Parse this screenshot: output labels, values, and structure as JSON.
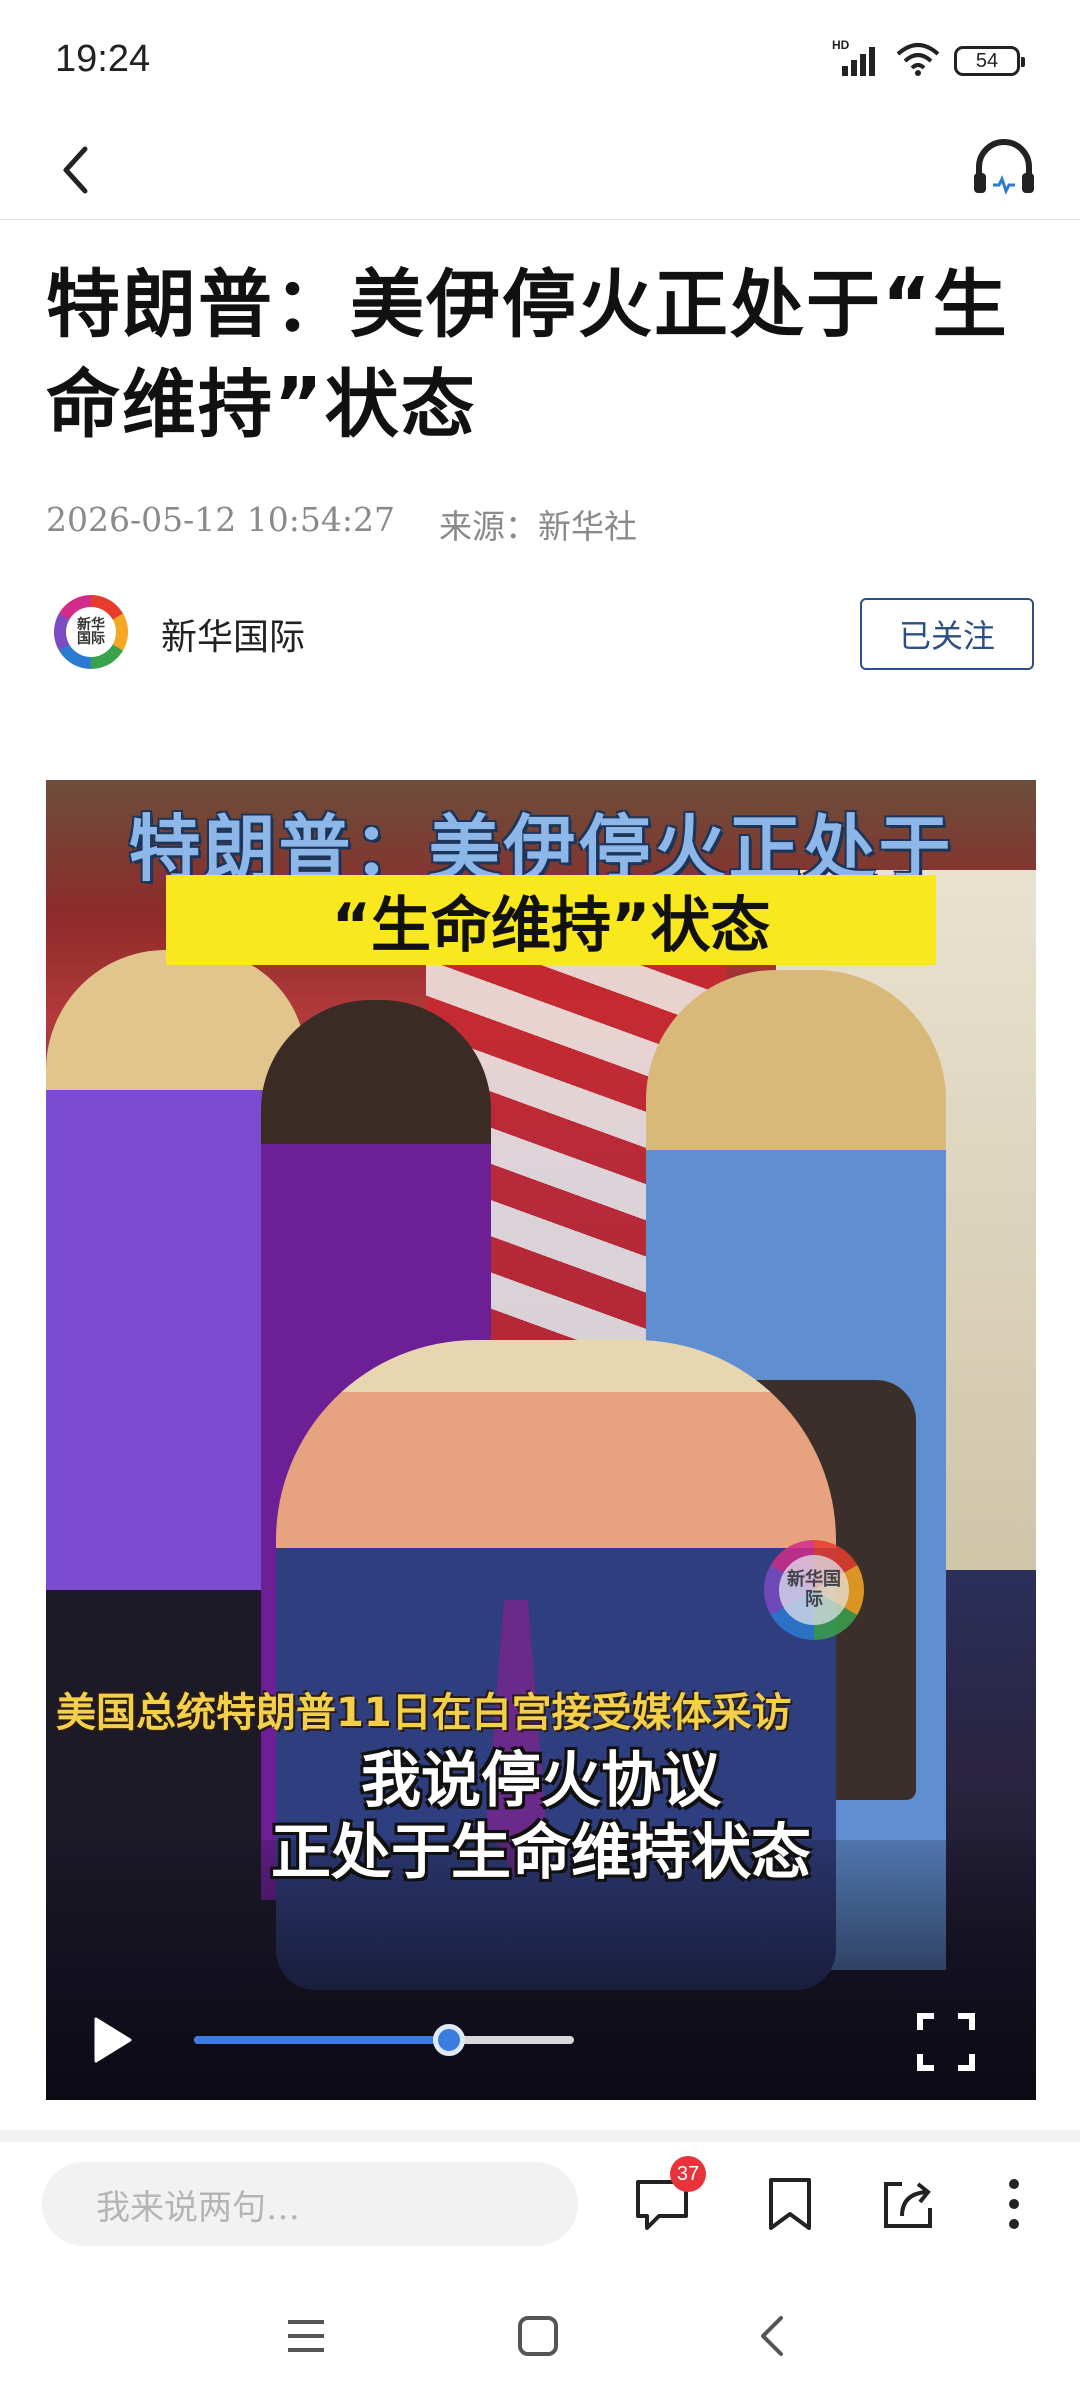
{
  "status_bar": {
    "time": "19:24",
    "network_label": "HD",
    "battery": "54",
    "icons": [
      "signal-icon",
      "wifi-icon",
      "battery-icon"
    ]
  },
  "nav": {
    "icons": [
      "back-arrow-icon",
      "headphones-icon"
    ]
  },
  "article": {
    "title": "特朗普：美伊停火正处于“生命维持”状态",
    "datetime": "2026-05-12 10:54:27",
    "source": "来源：新华社"
  },
  "author": {
    "logo_text": "新华国际",
    "name": "新华国际",
    "follow_label": "已关注"
  },
  "video": {
    "headline_top": "特朗普：美伊停火正处于",
    "headline_bottom": "“生命维持”状态",
    "watermark": "新华国际",
    "caption_small": "美国总统特朗普11日在白宫接受媒体采访",
    "caption_line1": "我说停火协议",
    "caption_line2": "正处于生命维持状态",
    "progress": 0.67,
    "colors": {
      "progress": "#3c7be0",
      "headline_bg": "#f9e81e"
    }
  },
  "comment_bar": {
    "placeholder": "我来说两句…",
    "comment_count": "37",
    "icons": [
      "comment-icon",
      "bookmark-icon",
      "share-icon",
      "more-icon"
    ]
  },
  "system_nav": {
    "icons": [
      "menu-icon",
      "home-icon",
      "back-icon"
    ]
  }
}
